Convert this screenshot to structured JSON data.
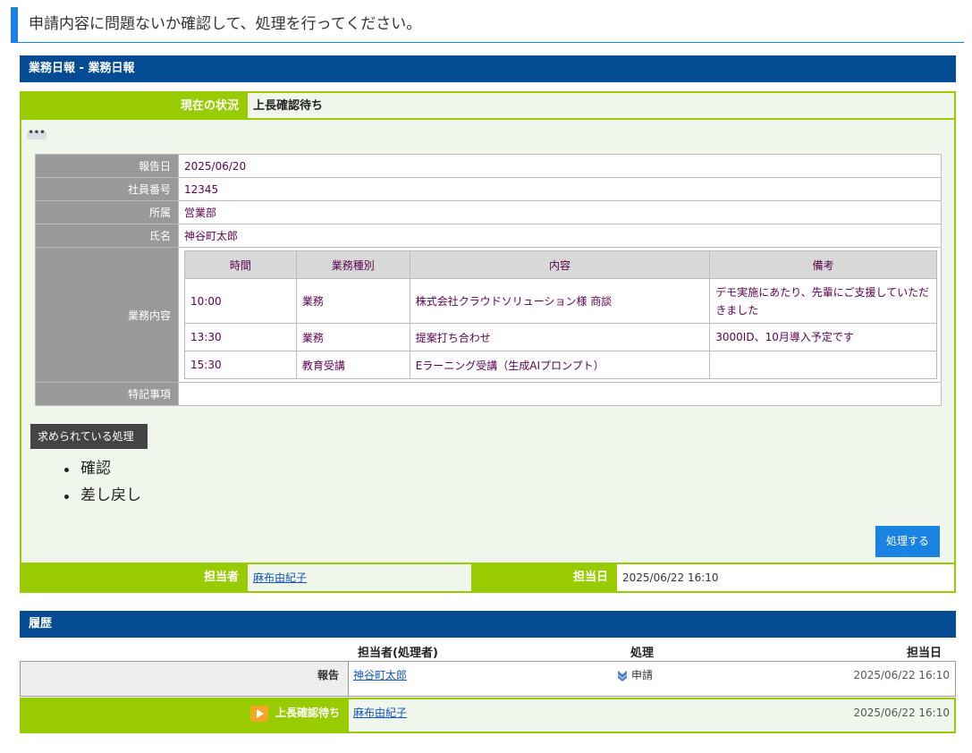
{
  "instruction": "申請内容に問題ないか確認して、処理を行ってください。",
  "form_title": "業務日報 - 業務日報",
  "status": {
    "label": "現在の状況",
    "value": "上長確認待ち"
  },
  "more_label": "•••",
  "info": {
    "report_date_label": "報告日",
    "report_date": "2025/06/20",
    "employee_no_label": "社員番号",
    "employee_no": "12345",
    "dept_label": "所属",
    "dept": "営業部",
    "name_label": "氏名",
    "name": "神谷町太郎",
    "tasks_label": "業務内容",
    "notes_label": "特記事項",
    "notes": ""
  },
  "tasks": {
    "headers": [
      "時間",
      "業務種別",
      "内容",
      "備考"
    ],
    "rows": [
      [
        "10:00",
        "業務",
        "株式会社クラウドソリューション様 商談",
        "デモ実施にあたり、先輩にご支援していただきました"
      ],
      [
        "13:30",
        "業務",
        "提案打ち合わせ",
        "3000ID、10月導入予定です"
      ],
      [
        "15:30",
        "教育受講",
        "Eラーニング受講（生成AIプロンプト）",
        ""
      ]
    ]
  },
  "required_label": "求められている処理",
  "actions": [
    "確認",
    "差し戻し"
  ],
  "process_button": "処理する",
  "assignee": {
    "label": "担当者",
    "value": "麻布由紀子",
    "date_label": "担当日",
    "date": "2025/06/22 16:10"
  },
  "history": {
    "title": "履歴",
    "headers": {
      "handler": "担当者(処理者)",
      "action": "処理",
      "date": "担当日"
    },
    "rows": [
      {
        "step": "報告",
        "handler": "神谷町太郎",
        "action": "申請",
        "date": "2025/06/22 16:10"
      },
      {
        "step": "上長確認待ち",
        "handler": "麻布由紀子",
        "action": "",
        "date": "2025/06/22 16:10"
      }
    ]
  },
  "colors": {
    "accent_blue": "#1a82e2",
    "header_navy": "#034c93",
    "lime": "#99cc00"
  }
}
